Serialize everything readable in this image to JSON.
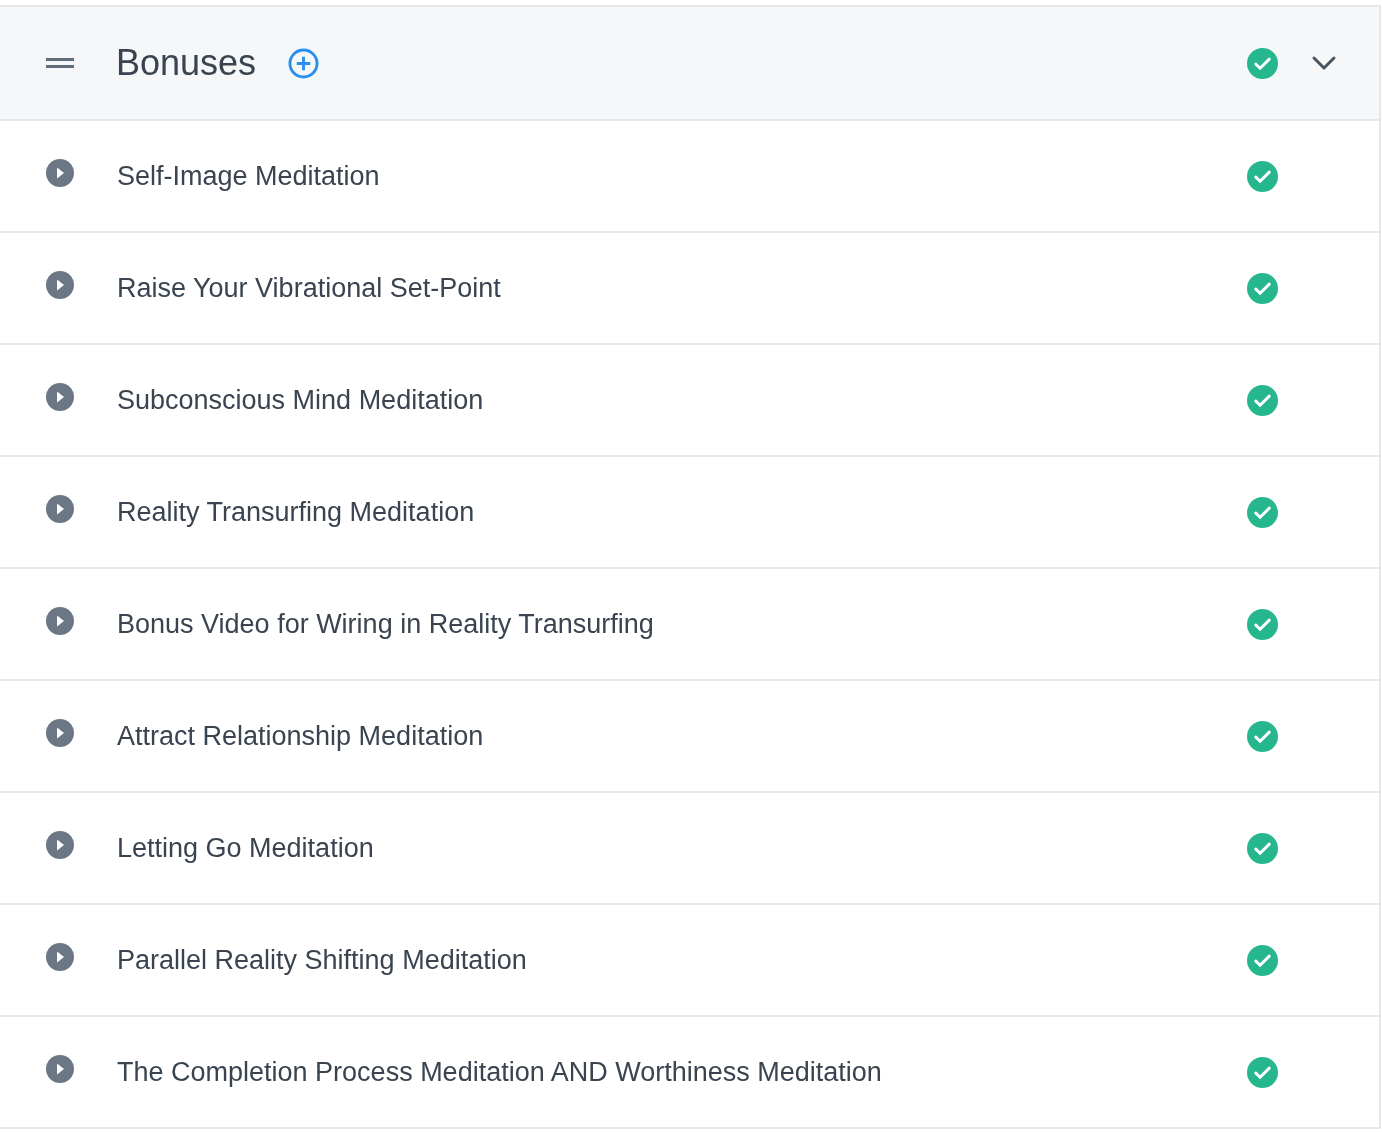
{
  "section": {
    "title": "Bonuses",
    "completed": true,
    "expanded": true
  },
  "lessons": [
    {
      "title": "Self-Image Meditation",
      "completed": true
    },
    {
      "title": "Raise Your Vibrational Set-Point",
      "completed": true
    },
    {
      "title": "Subconscious Mind Meditation",
      "completed": true
    },
    {
      "title": "Reality Transurfing Meditation",
      "completed": true
    },
    {
      "title": "Bonus Video for Wiring in Reality Transurfing",
      "completed": true
    },
    {
      "title": "Attract Relationship Meditation",
      "completed": true
    },
    {
      "title": "Letting Go Meditation",
      "completed": true
    },
    {
      "title": "Parallel Reality Shifting Meditation",
      "completed": true
    },
    {
      "title": "The Completion Process Meditation AND Worthiness Meditation",
      "completed": true
    }
  ]
}
